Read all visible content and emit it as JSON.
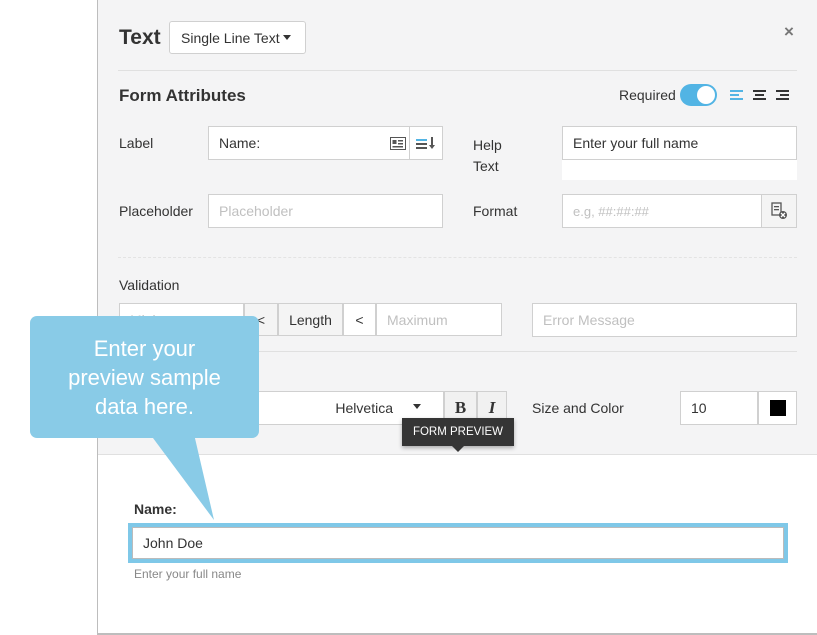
{
  "header": {
    "title": "Text",
    "type_dropdown": "Single Line Text",
    "close_glyph": "×"
  },
  "attributes": {
    "section_title": "Form Attributes",
    "required_label": "Required",
    "required_on": true,
    "label": {
      "label": "Label",
      "value": "Name:"
    },
    "help": {
      "label_line1": "Help",
      "label_line2": "Text",
      "value": "Enter your full name"
    },
    "placeholder": {
      "label": "Placeholder",
      "placeholder": "Placeholder"
    },
    "format": {
      "label": "Format",
      "placeholder": "e.g, ##:##:##"
    }
  },
  "validation": {
    "label": "Validation",
    "minimum_placeholder": "Minimum",
    "lt1": "<",
    "length": "Length",
    "lt2": "<",
    "maximum_placeholder": "Maximum",
    "error_placeholder": "Error Message"
  },
  "font": {
    "family": "Helvetica",
    "bold": "B",
    "italic": "I",
    "size_color_label": "Size and Color",
    "size": "10",
    "color": "#000000"
  },
  "tooltip": {
    "text": "FORM PREVIEW"
  },
  "preview": {
    "label": "Name:",
    "value": "John Doe",
    "help": "Enter your full name"
  },
  "callout": {
    "line1": "Enter your",
    "line2": "preview sample",
    "line3": "data here."
  },
  "colors": {
    "accent": "#52b4e4",
    "callout": "#89cbe7",
    "preview_border": "#7fc8e8"
  }
}
